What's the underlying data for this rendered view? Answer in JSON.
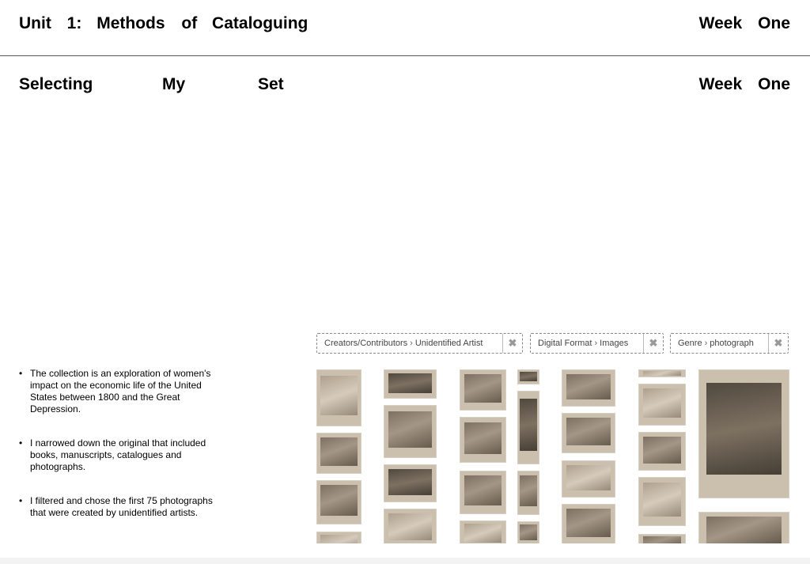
{
  "header": {
    "title_words": [
      "Unit",
      "1:",
      "Methods",
      "of",
      "Cataloguing"
    ],
    "week_words": [
      "Week",
      "One"
    ]
  },
  "section": {
    "title_words": [
      "Selecting",
      "My",
      "Set"
    ],
    "week_words": [
      "Week",
      "One"
    ]
  },
  "bullets": [
    "The collection is an exploration of women's impact on the economic life of the United States between 1800 and the Great Depression.",
    "I narrowed down the original that included books, manuscripts, catalogues and photographs.",
    "I filtered and chose the first 75 photographs that were created by unidentified artists."
  ],
  "filters": [
    {
      "field": "Creators/Contributors",
      "value": "Unidentified Artist",
      "remove_icon": "close-icon"
    },
    {
      "field": "Digital Format",
      "value": "Images",
      "remove_icon": "close-icon"
    },
    {
      "field": "Genre",
      "value": "photograph",
      "remove_icon": "close-icon"
    }
  ]
}
